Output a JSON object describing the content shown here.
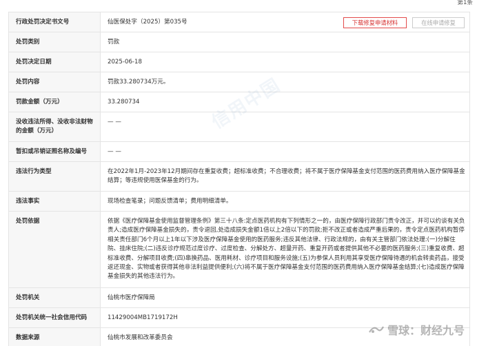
{
  "pagination": {
    "page_label": "第1条"
  },
  "actions": {
    "download_label": "下载修复申请材料",
    "repair_label": "在线申请修复"
  },
  "watermark": "信用中国",
  "brand": {
    "text": "雪球：财经九号"
  },
  "rows": [
    {
      "label": "行政处罚决定书文号",
      "value": "仙医保处字（2025）第035号"
    },
    {
      "label": "处罚类别",
      "value": "罚款"
    },
    {
      "label": "处罚决定日期",
      "value": "2025-06-18"
    },
    {
      "label": "处罚内容",
      "value": "罚款33.280734万元。"
    },
    {
      "label": "罚款金额（万元）",
      "value": "33.280734"
    },
    {
      "label": "没收违法所得、没收非法财物的金额（万元）",
      "value": "— —"
    },
    {
      "label": "暂扣或吊销证照名称及编号",
      "value": "— —"
    },
    {
      "label": "违法行为类型",
      "value": "在2022年1月-2023年12月期间存在重复收费；超标准收费；不合理收费；将不属于医疗保障基金支付范围的医药费用纳入医疗保障基金结算；等违规使用医保基金的行为。"
    },
    {
      "label": "违法事实",
      "value": "现场检查笔录；问题反馈清单；费用明细清单。"
    },
    {
      "label": "处罚依据",
      "value": "依据《医疗保障基金使用监督管理条例》第三十八条:定点医药机构有下列情形之一的，由医疗保障行政部门责令改正，并可以约谈有关负责人;造成医疗保障基金损失的，责令退回,处造成损失金额1倍以上2倍以下的罚款;拒不改正或者造成严重后果的，责令定点医药机构暂停相关责任部门6个月以上1年以下涉及医疗保障基金使用的医药服务;违反其他法律、行政法规的，由有关主管部门依法处理:(一)分解住院、挂床住院;(二)违反诊疗规范过度诊疗、过度检查、分解处方、超量开药、重复开药或者提供其他不必要的医药服务;(三)重复收费、超标准收费、分解项目收费;(四)串换药品、医用耗材、诊疗项目和服务设施;(五)为参保人员利用其享受医疗保障待遇的机会转卖药品，接受返还现金、实物或者获得其他非法利益提供便利;(六)将不属于医疗保障基金支付范围的医药费用纳入医疗保障基金结算;(七)造成医疗保障基金损失的其他违法行为。"
    },
    {
      "label": "处罚机关",
      "value": "仙桃市医疗保障局"
    },
    {
      "label": "处罚机关统一社会信用代码",
      "value": "11429004MB1719172H"
    },
    {
      "label": "数据来源",
      "value": "仙桃市发展和改革委员会"
    }
  ],
  "colors": {
    "download_border": "#e34b4b",
    "download_text": "#d63030",
    "label_bg": "#f7f7f7",
    "border": "#e4e4e4"
  }
}
